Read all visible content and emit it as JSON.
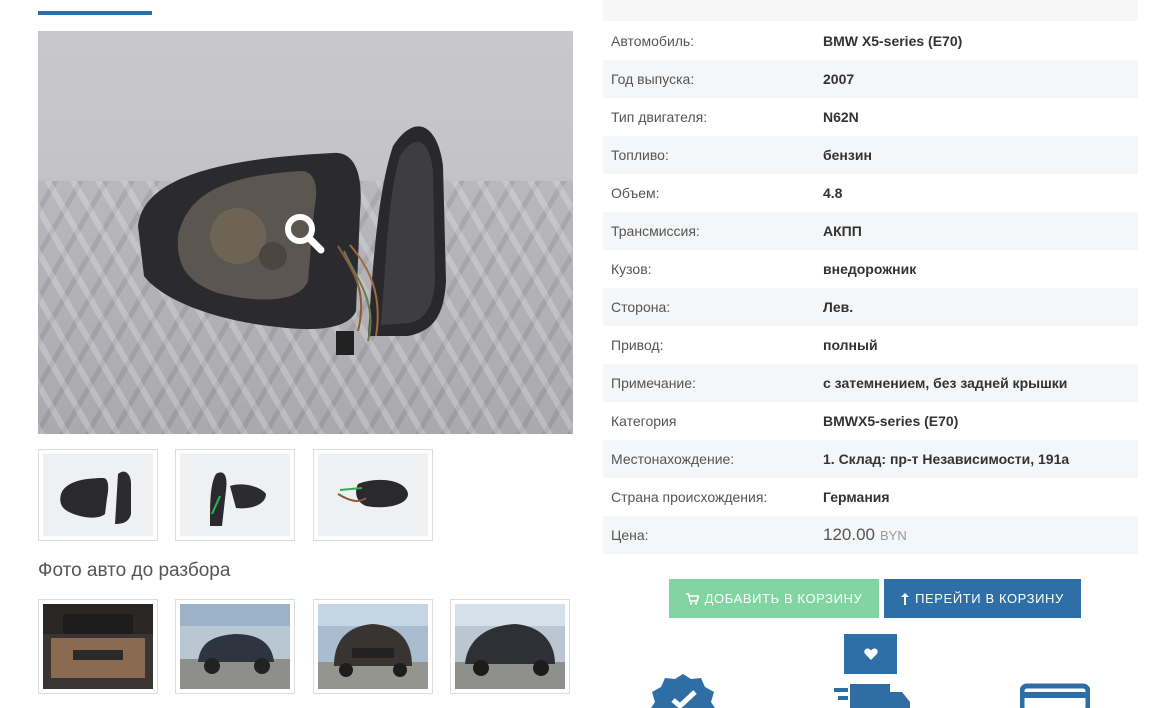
{
  "specs": [
    {
      "label": "Автомобиль:",
      "value": "BMW X5-series (E70)"
    },
    {
      "label": "Год выпуска:",
      "value": "2007"
    },
    {
      "label": "Тип двигателя:",
      "value": "N62N"
    },
    {
      "label": "Топливо:",
      "value": "бензин"
    },
    {
      "label": "Объем:",
      "value": "4.8"
    },
    {
      "label": "Трансмиссия:",
      "value": "АКПП"
    },
    {
      "label": "Кузов:",
      "value": "внедорожник"
    },
    {
      "label": "Сторона:",
      "value": "Лев."
    },
    {
      "label": "Привод:",
      "value": "полный"
    },
    {
      "label": "Примечание:",
      "value": "с затемнением, без задней крышки"
    },
    {
      "label": "Категория",
      "value": "BMWX5-series (E70)"
    },
    {
      "label": "Местонахождение:",
      "value": "1. Склад: пр-т Независимости, 191а"
    },
    {
      "label": "Страна происхождения:",
      "value": "Германия"
    }
  ],
  "price": {
    "label": "Цена:",
    "amount": "120.00",
    "currency": "BYN"
  },
  "buttons": {
    "add_to_cart": "ДОБАВИТЬ В КОРЗИНУ",
    "go_to_cart": "ПЕРЕЙТИ В КОРЗИНУ"
  },
  "section_title": "Фото авто до разбора",
  "icons": {
    "zoom": "magnifier-icon",
    "cart": "shopping-cart-icon",
    "go": "arrow-up-icon",
    "favorite": "heart-icon",
    "verified": "verified-badge-icon",
    "delivery": "delivery-truck-icon",
    "card": "credit-card-icon"
  },
  "colors": {
    "accent": "#2f6ea5",
    "add_button": "#82d4a0",
    "primary_button": "#2f6fa8"
  }
}
